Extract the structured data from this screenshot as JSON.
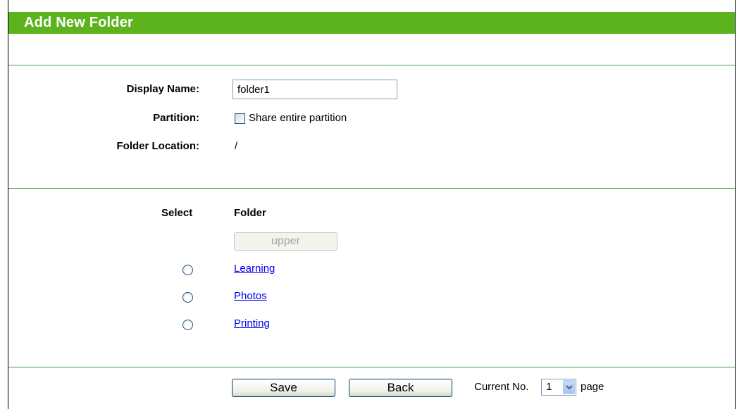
{
  "header": {
    "title": "Add New Folder"
  },
  "form": {
    "display_name_label": "Display Name:",
    "display_name_value": "folder1",
    "partition_label": "Partition:",
    "share_entire_partition_label": "Share entire partition",
    "share_entire_partition_checked": false,
    "folder_location_label": "Folder Location:",
    "folder_location_value": "/"
  },
  "folder_list": {
    "select_header": "Select",
    "folder_header": "Folder",
    "upper_button_label": "upper",
    "items": [
      {
        "name": "Learning",
        "selected": false
      },
      {
        "name": "Photos",
        "selected": false
      },
      {
        "name": "Printing",
        "selected": false
      }
    ]
  },
  "footer": {
    "save_label": "Save",
    "back_label": "Back",
    "current_no_label": "Current No.",
    "page_value": "1",
    "page_suffix": "page"
  },
  "colors": {
    "title_bar": "#5cb31d",
    "divider": "#4f9a4a",
    "link": "#0000ee"
  }
}
